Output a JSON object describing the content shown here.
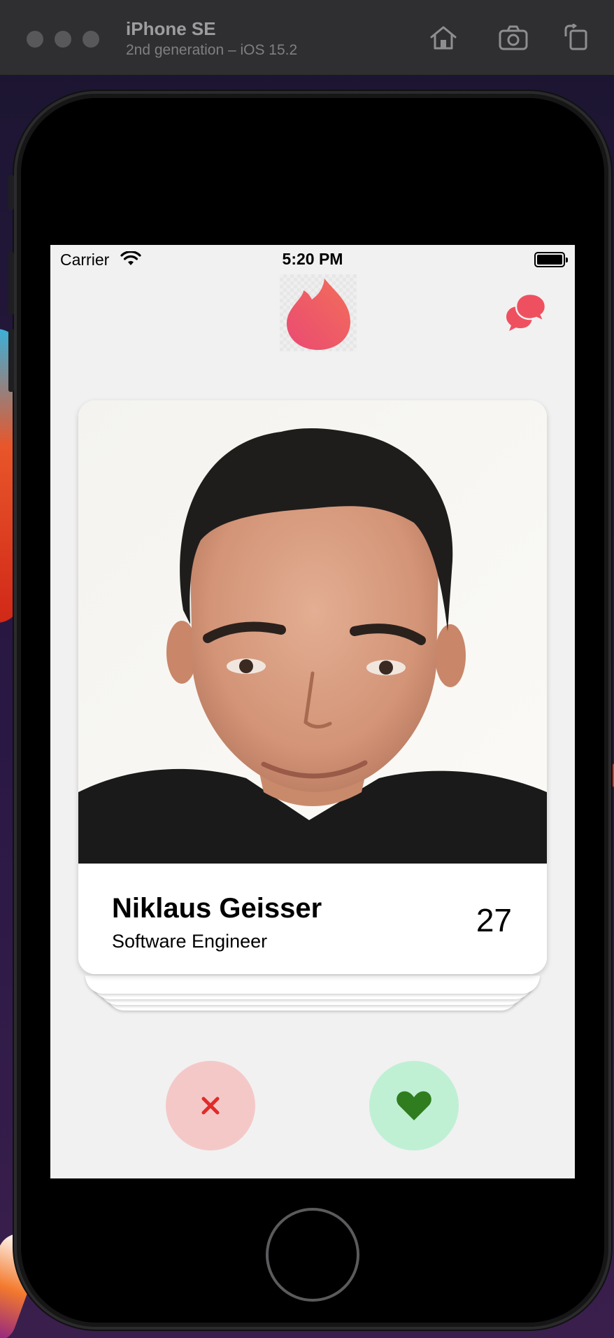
{
  "simulator": {
    "device_name": "iPhone SE",
    "device_subtitle": "2nd generation – iOS 15.2",
    "toolbar_icons": [
      "home-icon",
      "screenshot-icon",
      "rotate-icon"
    ]
  },
  "status_bar": {
    "carrier": "Carrier",
    "time": "5:20 PM",
    "battery_level": 1.0
  },
  "header": {
    "logo_icon": "flame-icon",
    "chat_icon": "chat-bubbles-icon"
  },
  "profile": {
    "name": "Niklaus Geisser",
    "job": "Software Engineer",
    "age": "27"
  },
  "actions": {
    "dislike_icon": "close-icon",
    "like_icon": "heart-icon"
  },
  "colors": {
    "brand": "#ef5060",
    "dislike_bg": "#f5c8c8",
    "dislike_fg": "#e02b2b",
    "like_bg": "#bff0d4",
    "like_fg": "#2f7d1f"
  }
}
